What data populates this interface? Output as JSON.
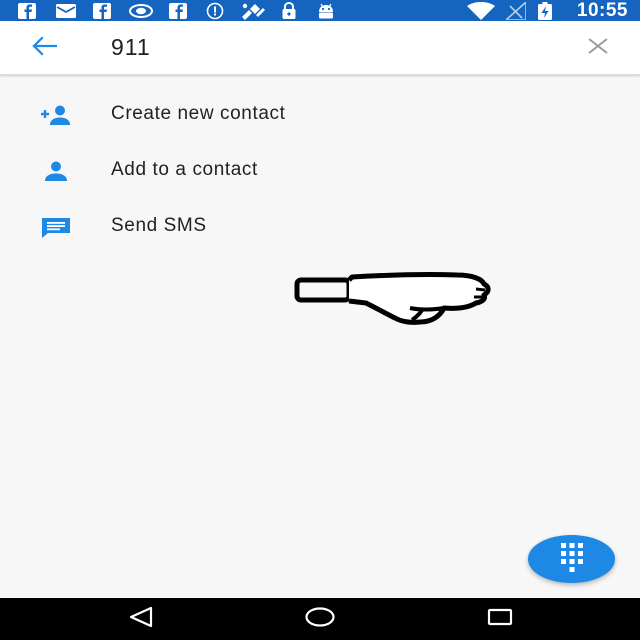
{
  "status_bar": {
    "time": "10:55",
    "color": "#1565c0",
    "left_icons": [
      "facebook-icon",
      "email-icon",
      "facebook-icon",
      "visibility-icon",
      "facebook-icon",
      "info-icon",
      "satellite-icon",
      "lock-icon",
      "android-icon"
    ],
    "right_icons": [
      "wifi-icon",
      "signal-icon",
      "battery-charging-icon"
    ]
  },
  "search": {
    "query": "911",
    "back_icon": "arrow-back-icon",
    "clear_icon": "close-icon"
  },
  "actions": [
    {
      "label": "Create new contact",
      "icon": "person-add-icon"
    },
    {
      "label": "Add to a contact",
      "icon": "person-icon"
    },
    {
      "label": "Send SMS",
      "icon": "message-icon"
    }
  ],
  "overlay": {
    "icon": "thumbs-down-icon"
  },
  "fab": {
    "icon": "dialpad-icon",
    "color": "#1e88e5"
  },
  "nav_bar": {
    "buttons": [
      "back-triangle-icon",
      "home-circle-icon",
      "recents-square-icon"
    ]
  },
  "accent_color": "#1e88e5"
}
